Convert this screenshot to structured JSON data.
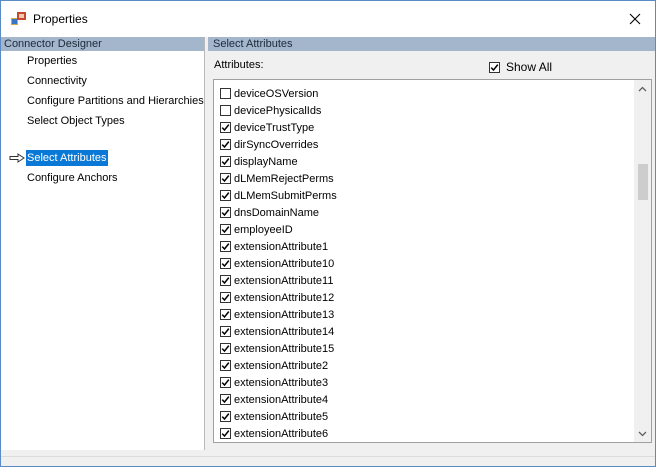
{
  "window": {
    "title": "Properties"
  },
  "left_panel": {
    "header": "Connector Designer",
    "items": [
      {
        "label": "Properties",
        "selected": false
      },
      {
        "label": "Connectivity",
        "selected": false
      },
      {
        "label": "Configure Partitions and Hierarchies",
        "selected": false
      },
      {
        "label": "Select Object Types",
        "selected": false
      },
      {
        "label": "Select Attributes",
        "selected": true
      },
      {
        "label": "Configure Anchors",
        "selected": false
      }
    ]
  },
  "right_panel": {
    "header": "Select Attributes",
    "attributes_label": "Attributes:",
    "show_all": {
      "label": "Show All",
      "checked": true
    },
    "attributes": [
      {
        "name": "deviceOSVersion",
        "checked": false
      },
      {
        "name": "devicePhysicalIds",
        "checked": false
      },
      {
        "name": "deviceTrustType",
        "checked": true
      },
      {
        "name": "dirSyncOverrides",
        "checked": true
      },
      {
        "name": "displayName",
        "checked": true
      },
      {
        "name": "dLMemRejectPerms",
        "checked": true
      },
      {
        "name": "dLMemSubmitPerms",
        "checked": true
      },
      {
        "name": "dnsDomainName",
        "checked": true
      },
      {
        "name": "employeeID",
        "checked": true
      },
      {
        "name": "extensionAttribute1",
        "checked": true
      },
      {
        "name": "extensionAttribute10",
        "checked": true
      },
      {
        "name": "extensionAttribute11",
        "checked": true
      },
      {
        "name": "extensionAttribute12",
        "checked": true
      },
      {
        "name": "extensionAttribute13",
        "checked": true
      },
      {
        "name": "extensionAttribute14",
        "checked": true
      },
      {
        "name": "extensionAttribute15",
        "checked": true
      },
      {
        "name": "extensionAttribute2",
        "checked": true
      },
      {
        "name": "extensionAttribute3",
        "checked": true
      },
      {
        "name": "extensionAttribute4",
        "checked": true
      },
      {
        "name": "extensionAttribute5",
        "checked": true
      },
      {
        "name": "extensionAttribute6",
        "checked": true
      }
    ]
  },
  "colors": {
    "selection": "#0a78d7",
    "panel_header": "#a3b6cc"
  }
}
